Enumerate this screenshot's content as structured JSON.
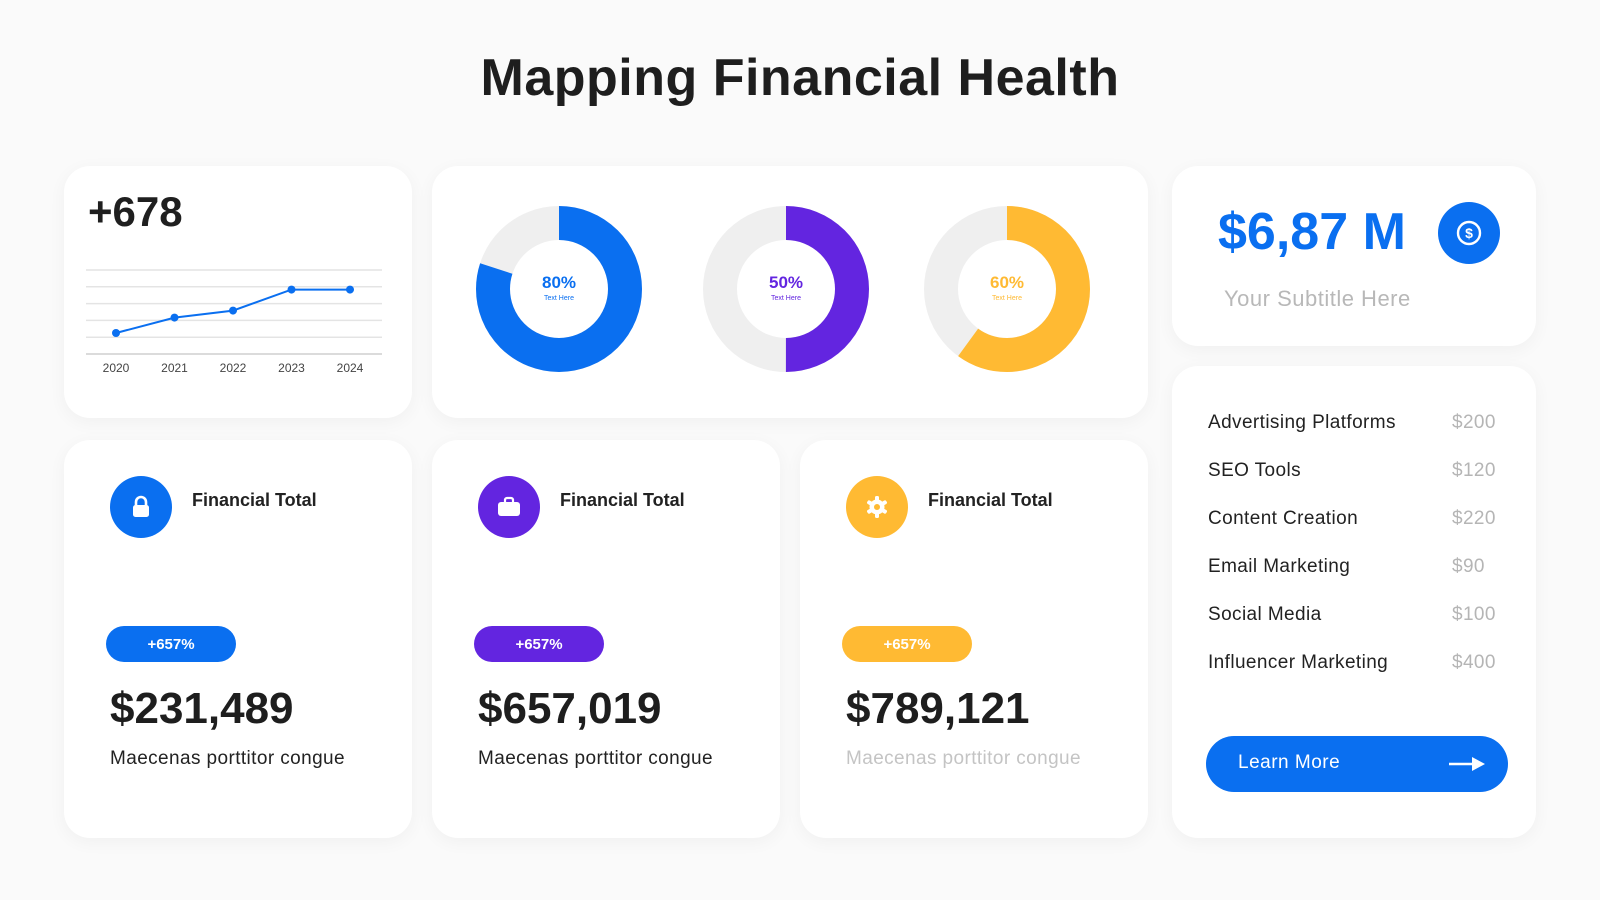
{
  "title": "Mapping Financial Health",
  "colors": {
    "blue": "#0a6ff0",
    "purple": "#6325e0",
    "yellow": "#ffba33",
    "track": "#efefef"
  },
  "line_card": {
    "value": "+678"
  },
  "revenue": {
    "value": "$6,87 M",
    "subtitle": "Your Subtitle Here",
    "icon": "dollar-coin-icon"
  },
  "stats": [
    {
      "label": "Financial Total",
      "badge": "+657%",
      "value": "$231,489",
      "desc": "Maecenas porttitor congue",
      "color": "#0a6ff0",
      "icon": "lock-icon"
    },
    {
      "label": "Financial Total",
      "badge": "+657%",
      "value": "$657,019",
      "desc": "Maecenas porttitor congue",
      "color": "#6325e0",
      "icon": "briefcase-icon"
    },
    {
      "label": "Financial Total",
      "badge": "+657%",
      "value": "$789,121",
      "desc": "Maecenas porttitor congue",
      "color": "#ffba33",
      "icon": "gear-icon"
    }
  ],
  "budget": {
    "items": [
      {
        "name": "Advertising Platforms",
        "value": "$200"
      },
      {
        "name": "SEO Tools",
        "value": "$120"
      },
      {
        "name": "Content Creation",
        "value": "$220"
      },
      {
        "name": "Email Marketing",
        "value": "$90"
      },
      {
        "name": "Social Media",
        "value": "$100"
      },
      {
        "name": "Influencer Marketing",
        "value": "$400"
      }
    ],
    "button_label": "Learn More"
  },
  "chart_data": [
    {
      "type": "line",
      "x": [
        "2020",
        "2021",
        "2022",
        "2023",
        "2024"
      ],
      "series": [
        {
          "values": [
            1.5,
            2.6,
            3.1,
            4.6,
            4.6
          ]
        }
      ],
      "ylim": [
        0,
        6
      ],
      "grid": true,
      "color": "#0a6ff0"
    },
    {
      "type": "pie",
      "donuts": [
        {
          "value": 80,
          "label": "80%",
          "sublabel": "Text Here",
          "color": "#0a6ff0"
        },
        {
          "value": 50,
          "label": "50%",
          "sublabel": "Text Here",
          "color": "#6325e0"
        },
        {
          "value": 60,
          "label": "60%",
          "sublabel": "Text Here",
          "color": "#ffba33"
        }
      ]
    }
  ]
}
